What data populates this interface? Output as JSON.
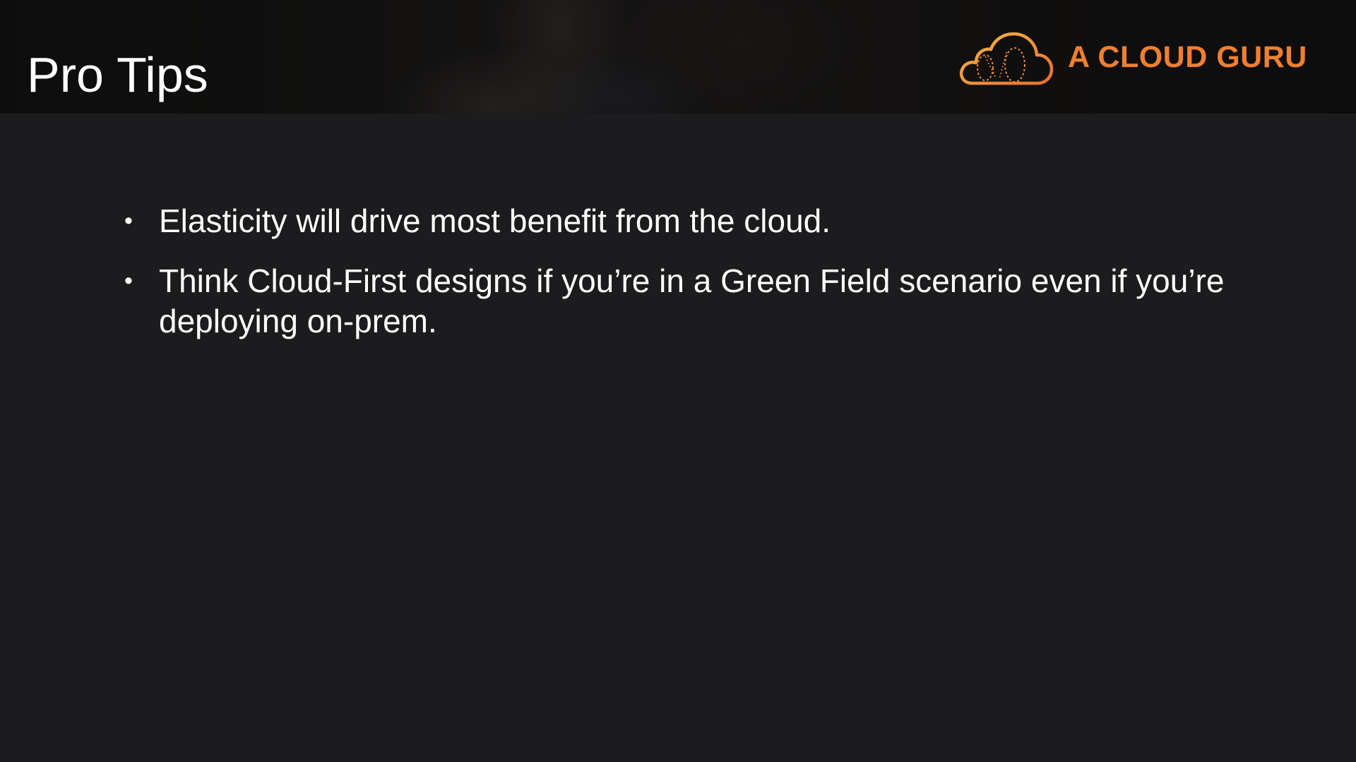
{
  "slide": {
    "title": "Pro Tips",
    "bullets": [
      {
        "text": "Elasticity will drive most benefit from the cloud."
      },
      {
        "text": "Think Cloud-First designs if you’re in a Green Field scenario even if you’re deploying on-prem."
      }
    ]
  },
  "logo": {
    "text": "A CLOUD GURU",
    "icon": "cloud-logo-icon",
    "color": "#ef7f2f",
    "accent": "#f0b34a"
  },
  "colors": {
    "background": "#1c1b1d",
    "text": "#ffffff"
  }
}
